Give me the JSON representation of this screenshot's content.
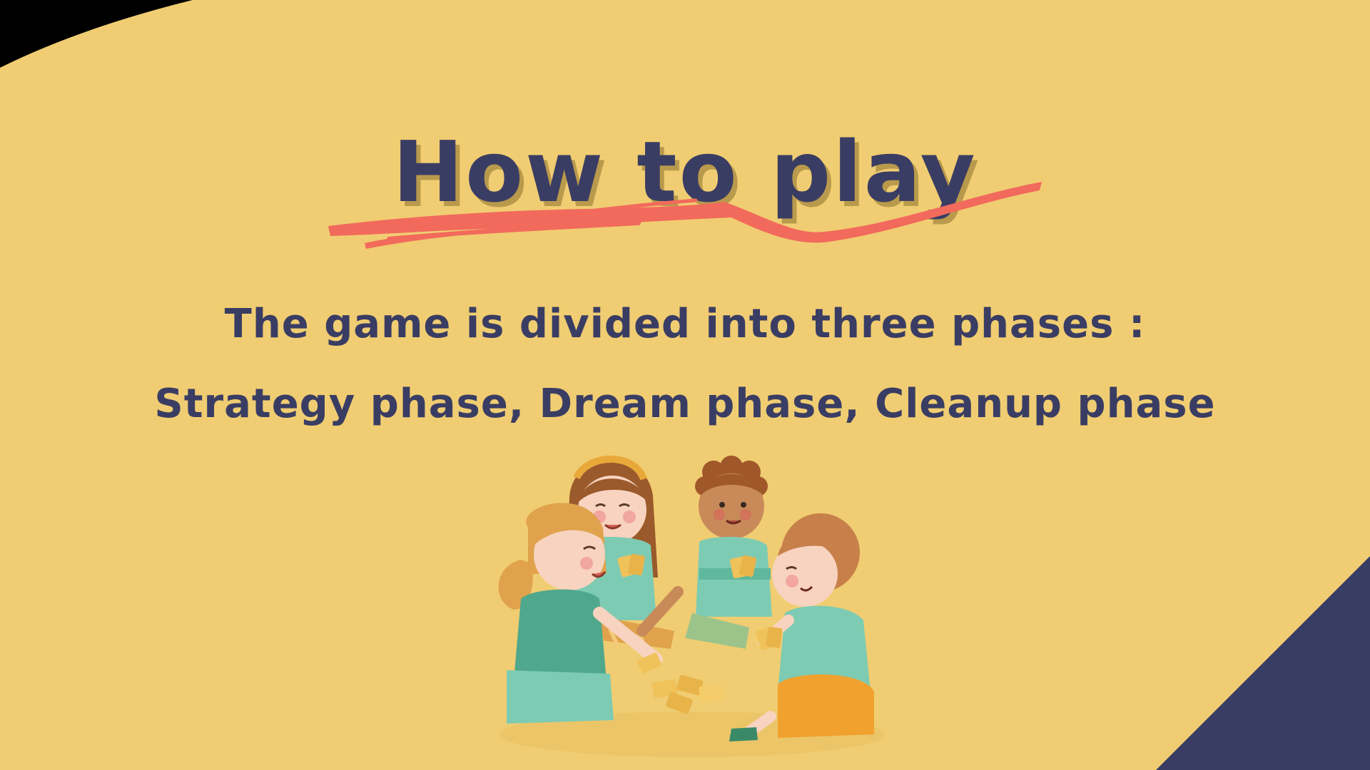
{
  "slide": {
    "title": "How to play",
    "intro": "The game is divided into three phases :",
    "phases": "Strategy phase, Dream phase, Cleanup phase"
  },
  "illustration": {
    "subject": "four-children-playing-cards"
  },
  "colors": {
    "background": "#f0cd72",
    "text": "#3a3d63",
    "text_shadow": "#b99a4c",
    "brush_stroke": "#f26a5c",
    "corner_navy": "#3a3d63",
    "corner_black": "#000000",
    "shirt_teal": "#7ecbb3",
    "hair_orange": "#e0a24c",
    "hair_brown": "#9b5a2b",
    "skin": "#f8d3c0"
  }
}
